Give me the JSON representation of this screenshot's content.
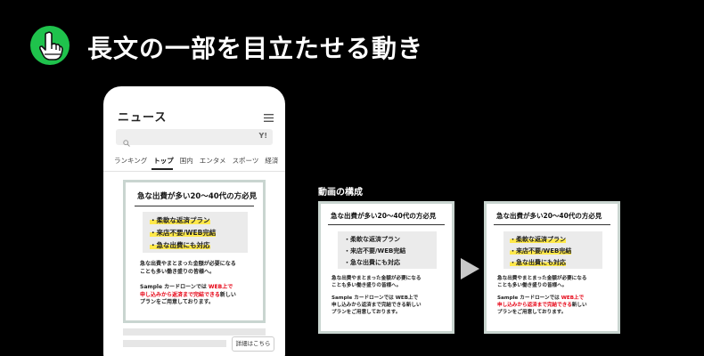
{
  "header": {
    "title": "長文の一部を目立たせる動き",
    "icon": "pointing-hand-icon",
    "accent": "#1fc24c"
  },
  "phone": {
    "title": "ニュース",
    "search": {
      "value": "",
      "placeholder": ""
    },
    "search_brand": "Y!",
    "tabs": [
      "ランキング",
      "トップ",
      "国内",
      "エンタメ",
      "スポーツ",
      "経済"
    ],
    "active_tab": "トップ",
    "detail_button": "詳細はこちら"
  },
  "ad": {
    "heading": "急な出費が多い20～40代の方必見",
    "points": [
      "・柔軟な返済プラン",
      "・来店不要/WEB完結",
      "・急な出費にも対応"
    ],
    "para1_line1": "急な出費やまとまった金額が必要になる",
    "para1_line2": "ことも多い働き盛りの皆様へ。",
    "para2_line1_a": "Sample カードローンでは ",
    "para2_line1_red": "WEB上で",
    "para2_line2_red": "申し込みから返済まで完結できる",
    "para2_line2_b": "新しい",
    "para2_line3": "プランをご用意しております。",
    "highlight_color": "#ffe94a",
    "red_color": "#e60012",
    "border_color": "#c9d5d0"
  },
  "structure": {
    "label": "動画の構成"
  }
}
